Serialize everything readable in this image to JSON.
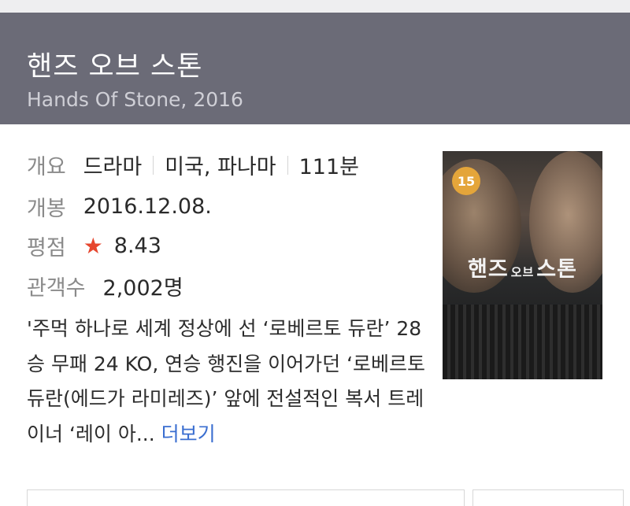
{
  "movie": {
    "title": "핸즈 오브 스톤",
    "original_title_year": "Hands Of Stone, 2016"
  },
  "info": {
    "overview_label": "개요",
    "genre": "드라마",
    "country": "미국, 파나마",
    "runtime": "111분",
    "release_label": "개봉",
    "release_date": "2016.12.08.",
    "rating_label": "평점",
    "rating_value": "8.43",
    "audience_label": "관객수",
    "audience_value": "2,002명"
  },
  "synopsis": {
    "text": "'주먹 하나로 세계 정상에 선 ‘로베르토 듀란’ 28승 무패 24 KO, 연승 행진을 이어가던 ‘로베르토 듀란(에드가 라미레즈)’ 앞에 전설적인 복서 트레이너 ‘레이 아...",
    "more_label": "더보기"
  },
  "poster": {
    "age_rating": "15",
    "title_part1": "핸즈",
    "title_part2": "오브",
    "title_part3": "스톤"
  },
  "colors": {
    "header_bg": "#6b6b77",
    "star": "#e6462e",
    "link": "#3a6ed0",
    "age_badge": "#e4a53a"
  },
  "icons": {
    "rating": "star-icon"
  }
}
